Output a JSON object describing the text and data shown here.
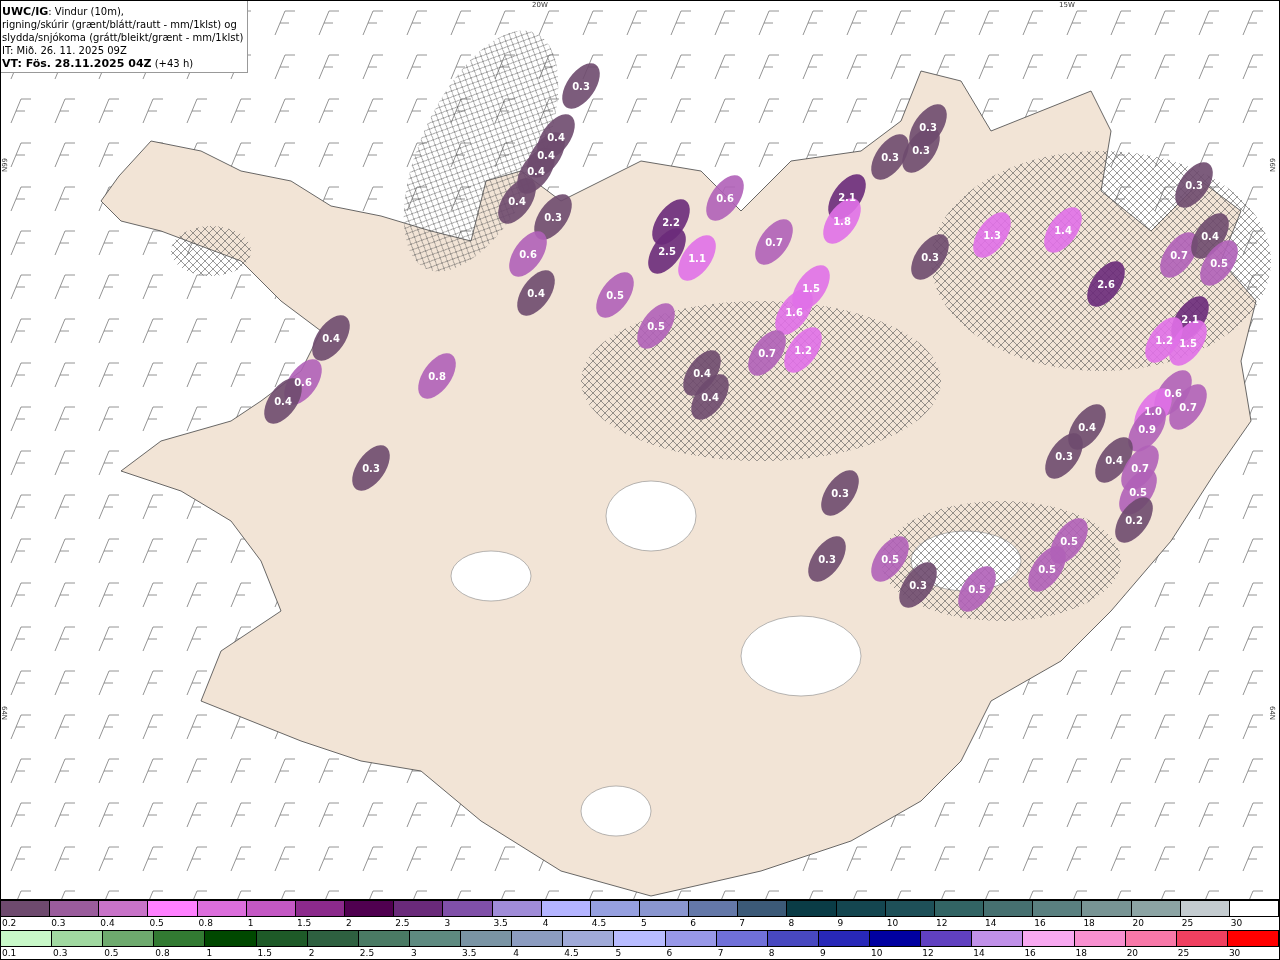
{
  "title_box": {
    "lines": [
      "**UWC/IG**: Vindur (10m),",
      "rigning/skúrir (grænt/blátt/rautt - mm/1klst) og",
      "slydda/snjókoma (grátt/bleikt/grænt - mm/1klst)",
      "IT: Mið. 26. 11. 2025 09Z",
      "**VT: Fös. 28.11.2025 04Z** (+43 h)"
    ]
  },
  "grid_labels": [
    {
      "text": "20W",
      "kind": "top"
    },
    {
      "text": "15W",
      "kind": "top"
    },
    {
      "text": "66N",
      "kind": "left"
    },
    {
      "text": "64N",
      "kind": "left"
    },
    {
      "text": "66N",
      "kind": "right"
    },
    {
      "text": "64N",
      "kind": "right"
    }
  ],
  "map_values": [
    "0.3",
    "0.4",
    "0.4",
    "0.4",
    "0.4",
    "0.3",
    "0.6",
    "0.4",
    "2.2",
    "2.5",
    "1.1",
    "0.5",
    "0.5",
    "0.6",
    "0.7",
    "2.1",
    "1.8",
    "1.5",
    "1.6",
    "1.2",
    "0.7",
    "0.3",
    "0.3",
    "0.3",
    "1.3",
    "1.4",
    "2.6",
    "0.3",
    "0.7",
    "0.4",
    "0.5",
    "2.1",
    "1.2",
    "1.5",
    "0.6",
    "0.7",
    "1.0",
    "0.9",
    "0.4",
    "0.3",
    "0.4",
    "0.7",
    "0.5",
    "0.2",
    "0.4",
    "0.4",
    "0.3",
    "0.4",
    "0.6",
    "0.4",
    "0.8",
    "0.3",
    "0.3",
    "0.3",
    "0.5",
    "0.3",
    "0.5",
    "0.5",
    "0.5"
  ],
  "legends": [
    {
      "items": [
        {
          "label": "0.2",
          "color": "#6e4a6e"
        },
        {
          "label": "0.3",
          "color": "#9a5c9c"
        },
        {
          "label": "0.4",
          "color": "#c873c8"
        },
        {
          "label": "0.5",
          "color": "#ff80ff"
        },
        {
          "label": "0.8",
          "color": "#dc6edc"
        },
        {
          "label": "1",
          "color": "#c458c4"
        },
        {
          "label": "1.5",
          "color": "#8c2a8c"
        },
        {
          "label": "2",
          "color": "#500050"
        },
        {
          "label": "2.5",
          "color": "#6a2a7a"
        },
        {
          "label": "3",
          "color": "#8050a8"
        },
        {
          "label": "3.5",
          "color": "#a08cd8"
        },
        {
          "label": "4",
          "color": "#b4b4ff"
        },
        {
          "label": "4.5",
          "color": "#96a0e0"
        },
        {
          "label": "5",
          "color": "#8a96d0"
        },
        {
          "label": "6",
          "color": "#6478a8"
        },
        {
          "label": "7",
          "color": "#3c5a78"
        },
        {
          "label": "8",
          "color": "#0a3c46"
        },
        {
          "label": "9",
          "color": "#144650"
        },
        {
          "label": "10",
          "color": "#1e5058"
        },
        {
          "label": "12",
          "color": "#326464"
        },
        {
          "label": "14",
          "color": "#467070"
        },
        {
          "label": "16",
          "color": "#5a8080"
        },
        {
          "label": "18",
          "color": "#789494"
        },
        {
          "label": "20",
          "color": "#8ca4a4"
        },
        {
          "label": "25",
          "color": "#c4ccd0"
        },
        {
          "label": "30",
          "color": "#ffffff"
        }
      ]
    },
    {
      "items": [
        {
          "label": "0.1",
          "color": "#c8f8c8"
        },
        {
          "label": "0.3",
          "color": "#a0d8a0"
        },
        {
          "label": "0.5",
          "color": "#6eaa6e"
        },
        {
          "label": "0.8",
          "color": "#327a32"
        },
        {
          "label": "1",
          "color": "#004800"
        },
        {
          "label": "1.5",
          "color": "#1e5a28"
        },
        {
          "label": "2",
          "color": "#2e6040"
        },
        {
          "label": "2.5",
          "color": "#4a7a64"
        },
        {
          "label": "3",
          "color": "#5e8a80"
        },
        {
          "label": "3.5",
          "color": "#7a94a4"
        },
        {
          "label": "4",
          "color": "#8c9cc0"
        },
        {
          "label": "4.5",
          "color": "#a0aad8"
        },
        {
          "label": "5",
          "color": "#b8bcff"
        },
        {
          "label": "6",
          "color": "#9898e8"
        },
        {
          "label": "7",
          "color": "#7070d8"
        },
        {
          "label": "8",
          "color": "#4848c0"
        },
        {
          "label": "9",
          "color": "#2828b8"
        },
        {
          "label": "10",
          "color": "#0000a0"
        },
        {
          "label": "12",
          "color": "#6040c0"
        },
        {
          "label": "14",
          "color": "#c090e8"
        },
        {
          "label": "16",
          "color": "#f8a8f0"
        },
        {
          "label": "18",
          "color": "#f890d0"
        },
        {
          "label": "20",
          "color": "#f878a8"
        },
        {
          "label": "25",
          "color": "#f04060"
        },
        {
          "label": "30",
          "color": "#ff0000"
        }
      ]
    }
  ]
}
